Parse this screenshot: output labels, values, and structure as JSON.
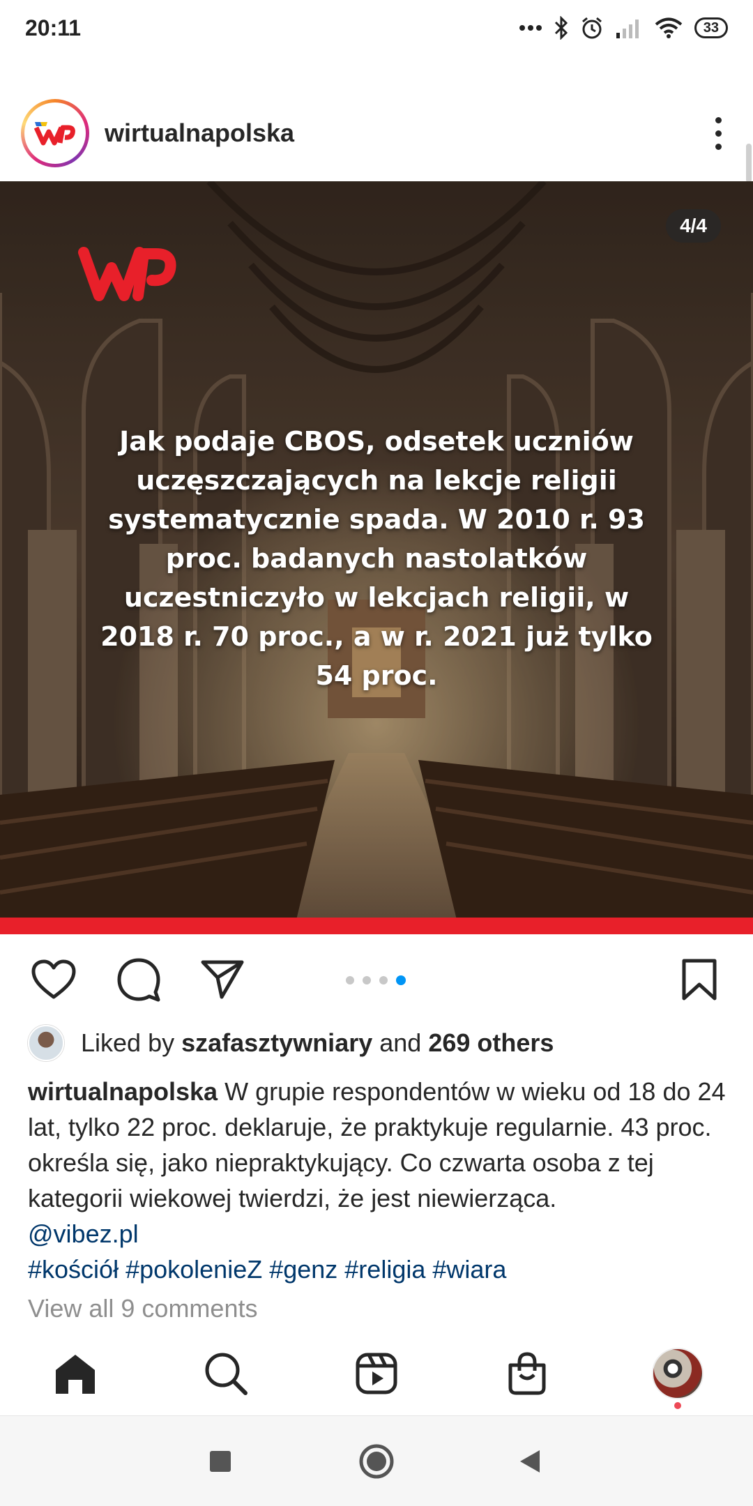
{
  "status_bar": {
    "time": "20:11",
    "battery": "33",
    "icons": [
      "dots-icon",
      "bluetooth-icon",
      "alarm-icon",
      "signal-icon",
      "wifi-icon",
      "battery-icon"
    ]
  },
  "post": {
    "username": "wirtualnapolska",
    "counter": "4/4",
    "image_text": "Jak podaje CBOS, odsetek uczniów uczęszczających na lekcje religii systematycznie spada. W 2010 r. 93 proc. badanych nastolatków uczestniczyło w lekcjach religii, w 2018 r. 70 proc., a w r. 2021 już tylko 54 proc.",
    "carousel": {
      "total": 4,
      "active": 4
    },
    "likes": {
      "prefix": "Liked by",
      "user": "szafasztywniary",
      "middle": "and",
      "others": "269 others"
    },
    "caption": {
      "username": "wirtualnapolska",
      "text": "W grupie respondentów w wieku od 18 do 24 lat, tylko 22 proc. deklaruje, że praktykuje regularnie. 43 proc. określa się, jako niepraktykujący. Co czwarta osoba z tej kategorii wiekowej twierdzi, że jest niewierząca.",
      "mention": "@vibez.pl",
      "hashtags": "#kościół #pokolenieZ #genz #religia #wiara"
    },
    "view_comments": "View all 9 comments"
  },
  "colors": {
    "accent_blue": "#0095f6",
    "link": "#00376b",
    "wp_red": "#e8202a",
    "notification": "#ed4956"
  },
  "bottom_nav": [
    "home-icon",
    "search-icon",
    "reels-icon",
    "shop-icon",
    "profile-avatar"
  ],
  "system_nav": [
    "recents-button",
    "home-button",
    "back-button"
  ]
}
